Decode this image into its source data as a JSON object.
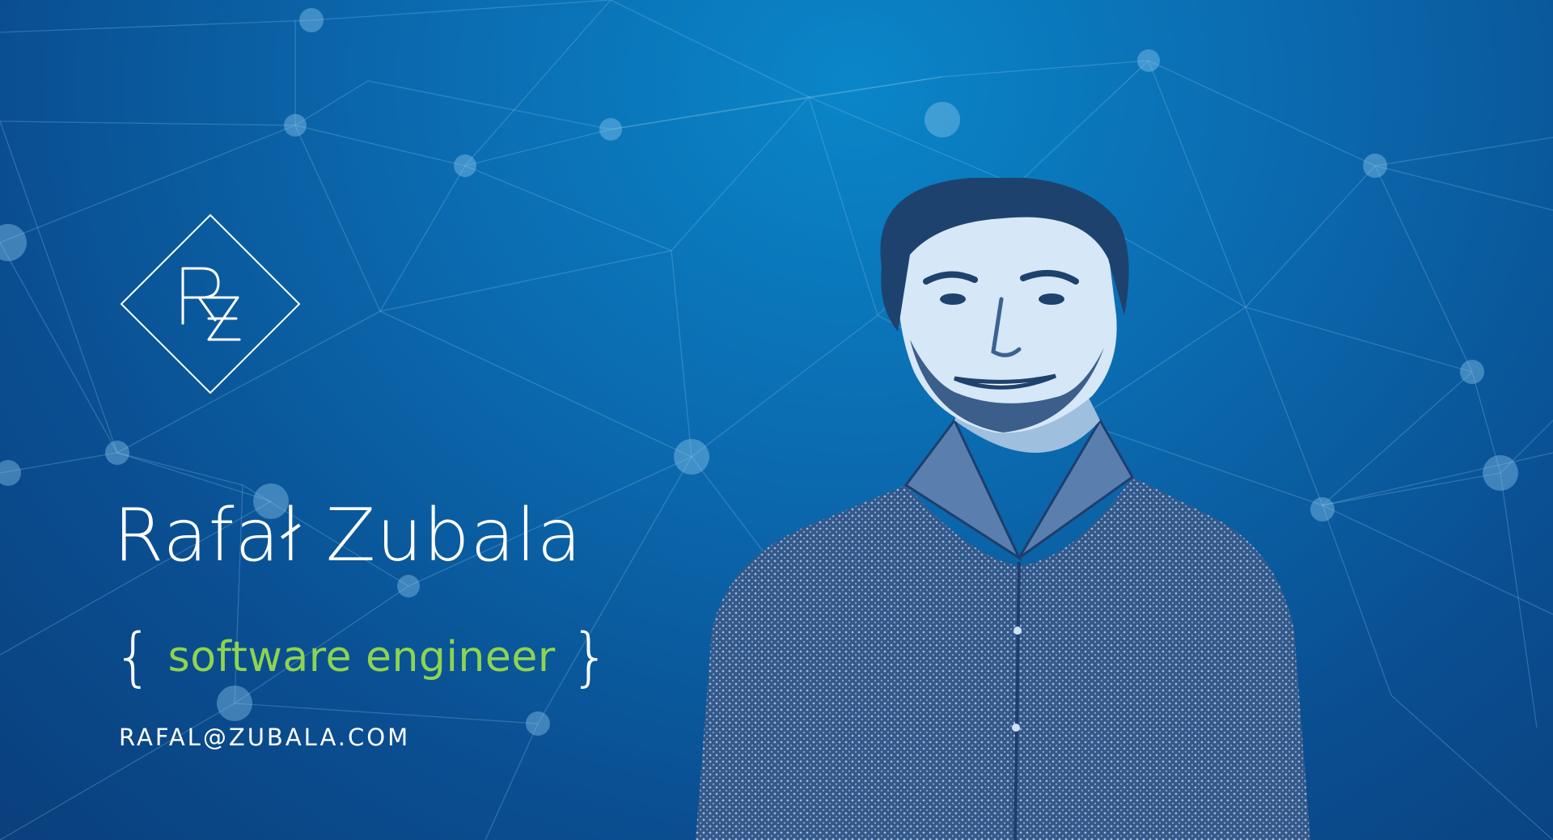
{
  "logo": {
    "monogram": "RZ"
  },
  "profile": {
    "name": "Rafał Zubala",
    "brace_open": "{",
    "role": "software engineer",
    "brace_close": "}",
    "email": "RAFAL@ZUBALA.COM"
  },
  "colors": {
    "background_top": "#0a86c8",
    "background_bottom": "#0a3f7c",
    "name_text": "#ffffff",
    "role_text": "#8fd44f",
    "portrait_tint": "#cfe2f5"
  },
  "icons": {
    "logo": "rz-diamond-icon",
    "background": "network-nodes-pattern"
  }
}
